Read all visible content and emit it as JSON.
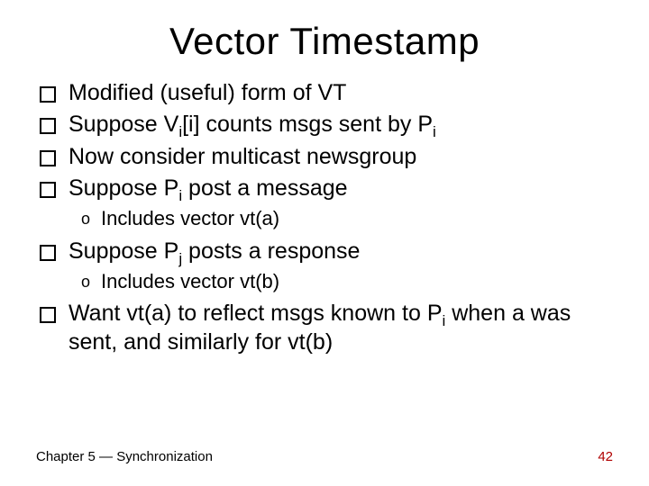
{
  "title": "Vector Timestamp",
  "bullets": {
    "b1": "Modified (useful) form of VT",
    "b2_pre": "Suppose V",
    "b2_sub1": "i",
    "b2_mid": "[i] counts msgs sent by P",
    "b2_sub2": "i",
    "b3": "Now consider multicast newsgroup",
    "b4_pre": "Suppose P",
    "b4_sub": "i",
    "b4_post": " post a message",
    "b4a": "Includes vector vt(a)",
    "b5_pre": "Suppose P",
    "b5_sub": "j",
    "b5_post": " posts a response",
    "b5a": "Includes vector vt(b)",
    "b6_pre": "Want vt(a) to reflect msgs known to P",
    "b6_sub": "i",
    "b6_post": " when a was sent, and similarly for vt(b)"
  },
  "footer": {
    "left": "Chapter 5 — Synchronization",
    "right": "42"
  }
}
